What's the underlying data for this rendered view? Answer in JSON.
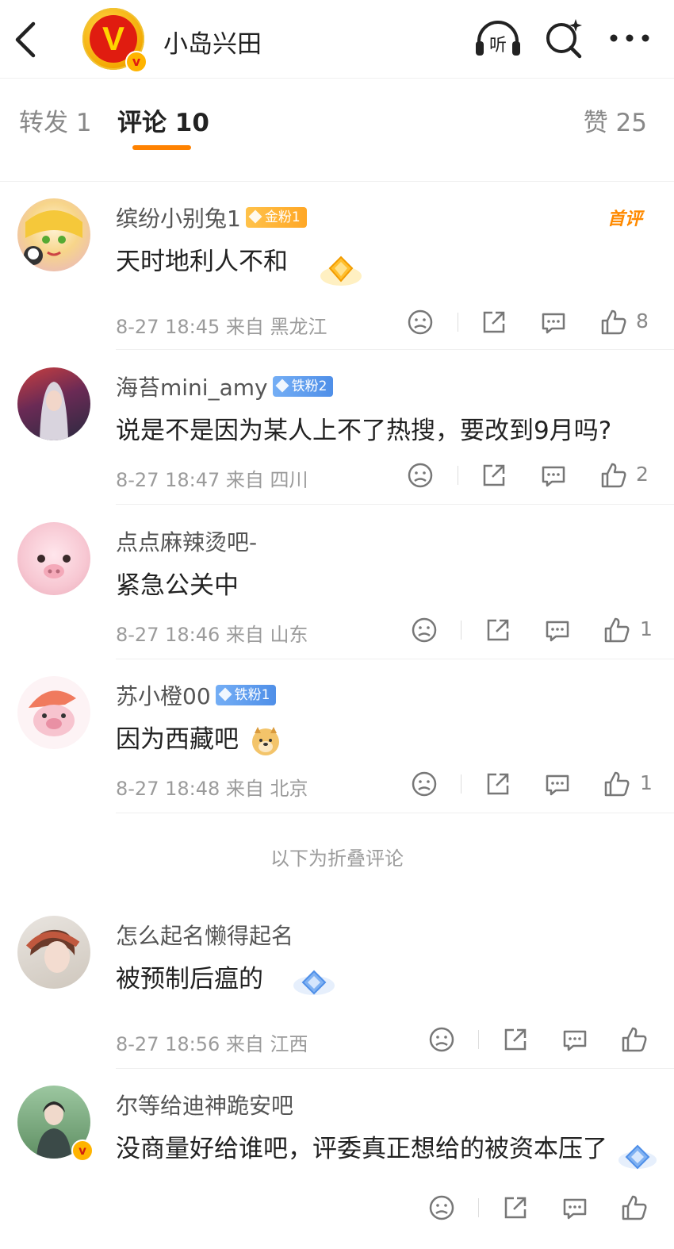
{
  "header": {
    "title": "小岛兴田",
    "listen_label": "听"
  },
  "tabs": [
    {
      "label": "转发 1"
    },
    {
      "label": "评论 10"
    },
    {
      "label": "赞 25"
    }
  ],
  "comments": [
    {
      "user": "缤纷小别兔1",
      "fan_badge": "金粉1",
      "first_tag": "首评",
      "text": "天时地利人不和",
      "time": "8-27 18:45",
      "location": "来自 黑龙江",
      "likes": "8"
    },
    {
      "user": "海苔mini_amy",
      "fan_badge": "铁粉2",
      "text": "说是不是因为某人上不了热搜，要改到9月吗?",
      "time": "8-27 18:47",
      "location": "来自 四川",
      "likes": "2"
    },
    {
      "user": "点点麻辣烫吧-",
      "text": "紧急公关中",
      "time": "8-27 18:46",
      "location": "来自 山东",
      "likes": "1"
    },
    {
      "user": "苏小橙00",
      "fan_badge": "铁粉1",
      "text": "因为西藏吧",
      "time": "8-27 18:48",
      "location": "来自 北京",
      "likes": "1"
    },
    {
      "user": "怎么起名懒得起名",
      "text": "被预制后瘟的",
      "time": "8-27 18:56",
      "location": "来自 江西",
      "likes": ""
    },
    {
      "user": "尔等给迪神跪安吧",
      "text": "没商量好给谁吧，评委真正想给的被资本压了",
      "time": "",
      "location": "",
      "likes": ""
    }
  ],
  "fold_label": "以下为折叠评论",
  "colors": {
    "accent": "#ff8200",
    "gold_fan": "#ffae32",
    "iron_fan": "#5b9bec"
  }
}
